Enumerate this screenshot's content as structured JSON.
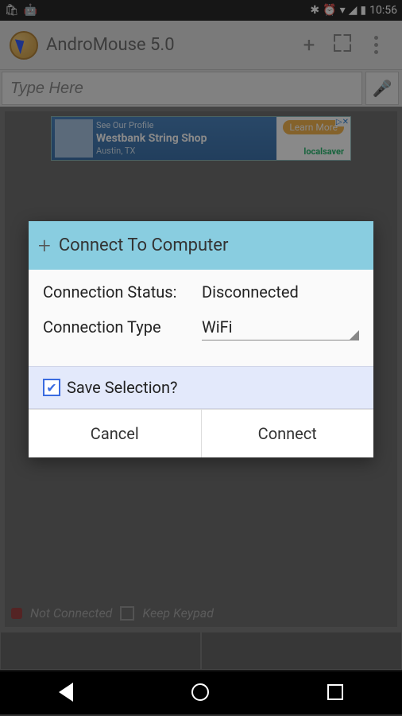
{
  "status": {
    "time": "10:56"
  },
  "actionbar": {
    "title": "AndroMouse 5.0"
  },
  "search": {
    "placeholder": "Type Here"
  },
  "ad": {
    "line1": "See Our Profile",
    "line2": "Westbank String Shop",
    "line3": "Austin, TX",
    "learn": "Learn More",
    "brand": "localsaver"
  },
  "footer": {
    "status": "Not Connected",
    "keep": "Keep Keypad"
  },
  "dialog": {
    "title": "Connect To Computer",
    "status_label": "Connection Status:",
    "status_value": "Disconnected",
    "type_label": "Connection Type",
    "type_value": "WiFi",
    "save_label": "Save Selection?",
    "cancel": "Cancel",
    "connect": "Connect"
  }
}
